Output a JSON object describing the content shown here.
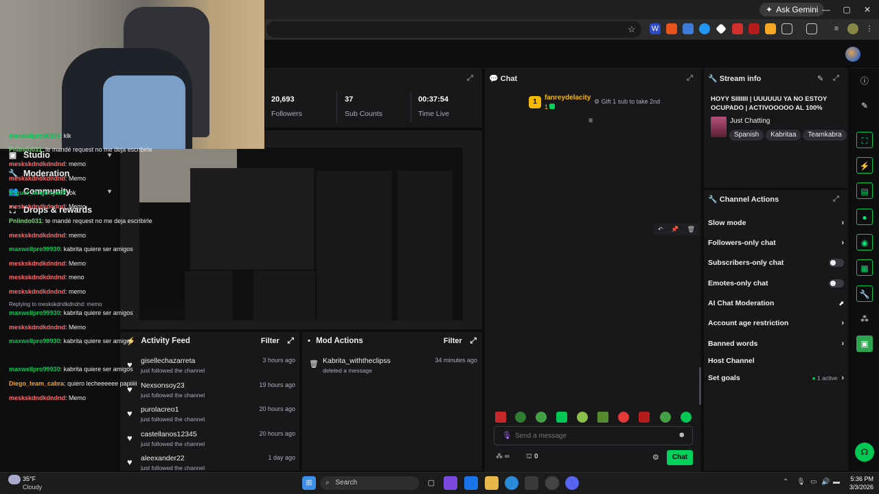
{
  "browser": {
    "ask_gemini": "Ask Gemini",
    "window_controls": [
      "—",
      "▢",
      "✕"
    ]
  },
  "left_nav": {
    "items": [
      {
        "label": "Studio",
        "icon": "studio-icon",
        "has_chevron": true
      },
      {
        "label": "Moderation",
        "icon": "wrench-icon",
        "has_chevron": false
      },
      {
        "label": "Community",
        "icon": "community-icon",
        "has_chevron": true
      },
      {
        "label": "Drops & rewards",
        "icon": "drops-icon",
        "has_chevron": false
      }
    ]
  },
  "stats": [
    {
      "value": "20,693",
      "label": "Followers"
    },
    {
      "value": "37",
      "label": "Sub Counts"
    },
    {
      "value": "00:37:54",
      "label": "Time Live"
    }
  ],
  "activity_feed": {
    "title": "Activity Feed",
    "filter": "Filter",
    "items": [
      {
        "name": "gisellechazarreta",
        "sub": "just followed the channel",
        "time": "3 hours ago"
      },
      {
        "name": "Nexsonsoy23",
        "sub": "just followed the channel",
        "time": "19 hours ago"
      },
      {
        "name": "purolacreo1",
        "sub": "just followed the channel",
        "time": "20 hours ago"
      },
      {
        "name": "castellanos12345",
        "sub": "just followed the channel",
        "time": "20 hours ago"
      },
      {
        "name": "aleexander22",
        "sub": "just followed the channel",
        "time": "1 day ago"
      }
    ]
  },
  "mod_actions": {
    "title": "Mod Actions",
    "filter": "Filter",
    "items": [
      {
        "name": "Kabrita_withtheclipss",
        "sub": "deleted a message",
        "time": "34 minutes ago"
      }
    ]
  },
  "chat": {
    "title": "Chat",
    "leader": {
      "rank": "1",
      "name": "fanreydelacity",
      "count": "1",
      "gift_text": "Gift 1 sub to take 2nd"
    },
    "messages": [
      {
        "user": "maxwellpro99930",
        "color": "#00c853",
        "text": "klk"
      },
      {
        "user": "Pnlindo031",
        "color": "#7cd67c",
        "text": "te mandé request no me deja escribirle"
      },
      {
        "user": "meskskdndkdndnd",
        "color": "#ff6a6a",
        "text": "memo"
      },
      {
        "user": "meskskdndkdndnd",
        "color": "#ff6a6a",
        "text": "Memo"
      },
      {
        "user": "Miguel_kingboyx33",
        "color": "#00c853",
        "text": "ok"
      },
      {
        "user": "meskskdndkdndnd",
        "color": "#ff6a6a",
        "text": "Memo"
      },
      {
        "user": "Pnlindo031",
        "color": "#7cd67c",
        "text": " te mandé request no me deja escribirle"
      },
      {
        "user": "meskskdndkdndnd",
        "color": "#ff6a6a",
        "text": "memo"
      },
      {
        "user": "maxwellpro99930",
        "color": "#00c853",
        "text": "kabrita quiere ser amigos"
      },
      {
        "user": "meskskdndkdndnd",
        "color": "#ff6a6a",
        "text": "Memo"
      },
      {
        "user": "meskskdndkdndnd",
        "color": "#ff6a6a",
        "text": "meno"
      },
      {
        "user": "meskskdndkdndnd",
        "color": "#ff6a6a",
        "text": "memo"
      },
      {
        "reply": "Replying to meskskdndkdndnd: memo"
      },
      {
        "user": "maxwellpro99930",
        "color": "#00c853",
        "text": "kabrita quiere ser amigos"
      },
      {
        "user": "meskskdndkdndnd",
        "color": "#ff6a6a",
        "text": "Memo"
      },
      {
        "user": "maxwellpro99930",
        "color": "#00c853",
        "text": "kabrita quiere ser amigos"
      },
      {
        "user": "maxwellpro99930",
        "color": "#00c853",
        "text": "kabrita quiere ser amigos"
      },
      {
        "user": "Diego_team_cabra",
        "color": "#f5a623",
        "text": "quiero lecheeeeee papiiiii"
      },
      {
        "user": "meskskdndkdndnd",
        "color": "#ff6a6a",
        "text": "Memo"
      }
    ],
    "input_placeholder": "Send a message",
    "points": "0",
    "send_label": "Chat"
  },
  "stream_info": {
    "title": "Stream info",
    "stream_title": "HOYY SIIIIIII | UUUUUU YA NO ESTOY OCUPADO | ACTIVOOOOO AL 100%",
    "category": "Just Chatting",
    "tags": [
      "Spanish",
      "Kabritaa",
      "Teamkabra"
    ]
  },
  "channel_actions": {
    "title": "Channel Actions",
    "items": [
      {
        "label": "Slow mode",
        "control": "chevron"
      },
      {
        "label": "Followers-only chat",
        "control": "chevron"
      },
      {
        "label": "Subscribers-only chat",
        "control": "toggle"
      },
      {
        "label": "Emotes-only chat",
        "control": "toggle"
      },
      {
        "label": "AI Chat Moderation",
        "control": "external"
      },
      {
        "label": "Account age restriction",
        "control": "chevron"
      },
      {
        "label": "Banned words",
        "control": "chevron"
      },
      {
        "label": "Host Channel",
        "control": "none"
      },
      {
        "label": "Set goals",
        "control": "chevron",
        "status": "1 active"
      }
    ]
  },
  "taskbar": {
    "weather_temp": "35°F",
    "weather_desc": "Cloudy",
    "search_placeholder": "Search",
    "time": "5:36 PM",
    "date": "3/3/2026"
  },
  "colors": {
    "accent": "#00d15c",
    "panel": "#18181b",
    "background": "#0e0e10"
  }
}
